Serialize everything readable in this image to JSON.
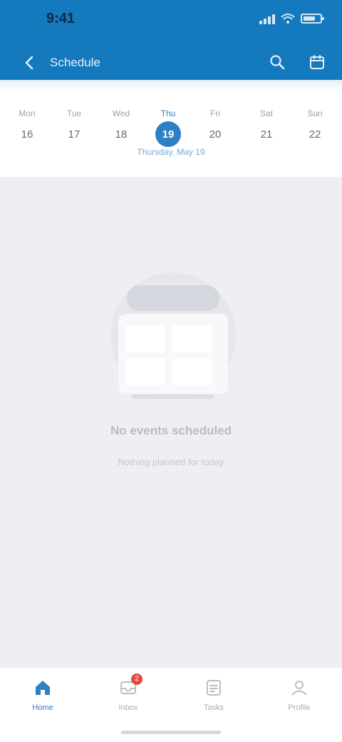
{
  "status_bar": {
    "time": "9:41",
    "signal_icon": "signal-icon",
    "wifi_icon": "wifi-icon",
    "battery_icon": "battery-icon"
  },
  "app_bar": {
    "title": "Schedule",
    "back_icon": "chevron-left-icon",
    "actions": [
      {
        "icon": "search-icon"
      },
      {
        "icon": "calendar-icon"
      }
    ]
  },
  "day_strip": {
    "days": [
      {
        "name": "Mon",
        "num": "16",
        "selected": false
      },
      {
        "name": "Tue",
        "num": "17",
        "selected": false
      },
      {
        "name": "Wed",
        "num": "18",
        "selected": false
      },
      {
        "name": "Thu",
        "num": "19",
        "selected": true
      },
      {
        "name": "Fri",
        "num": "20",
        "selected": false
      },
      {
        "name": "Sat",
        "num": "21",
        "selected": false
      },
      {
        "name": "Sun",
        "num": "22",
        "selected": false
      }
    ],
    "selected_label": "Thursday, May 19"
  },
  "empty_state": {
    "illustration_icon": "calendar-illustration-icon",
    "title": "No events scheduled",
    "subtitle": "Nothing planned for today"
  },
  "bottom_nav": {
    "items": [
      {
        "label": "Home",
        "icon": "home-icon",
        "active": true,
        "badge": ""
      },
      {
        "label": "Inbox",
        "icon": "inbox-icon",
        "active": false,
        "badge": "2"
      },
      {
        "label": "Tasks",
        "icon": "tasks-icon",
        "active": false,
        "badge": ""
      },
      {
        "label": "Profile",
        "icon": "profile-icon",
        "active": false,
        "badge": ""
      }
    ]
  },
  "colors": {
    "header": "#1479bd",
    "accent": "#2e7fc4",
    "badge": "#e7493f",
    "background": "#eeeef3"
  }
}
